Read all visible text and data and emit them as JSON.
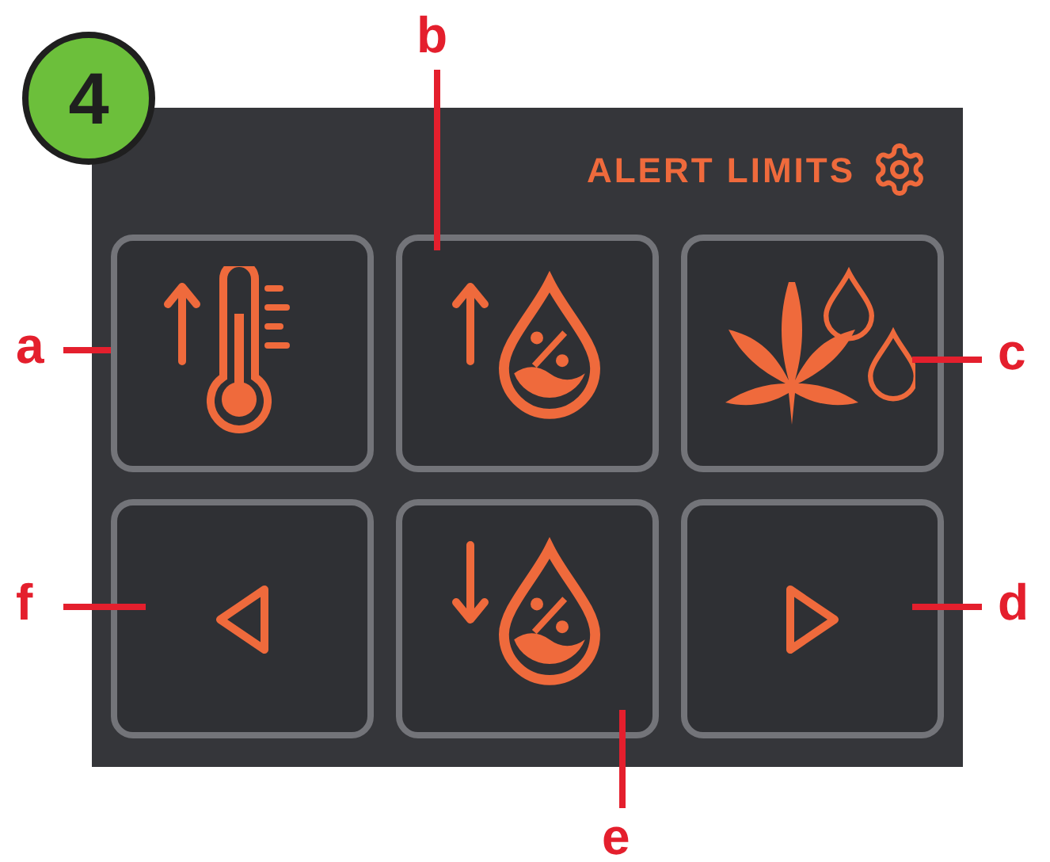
{
  "badge": "4",
  "panel": {
    "title": "ALERT LIMITS"
  },
  "buttons": [
    {
      "kind": "temp-up",
      "callout": "a"
    },
    {
      "kind": "humidity-up",
      "callout": "b"
    },
    {
      "kind": "plant-water",
      "callout": "c"
    },
    {
      "kind": "prev",
      "callout": "f"
    },
    {
      "kind": "humidity-down",
      "callout": "e"
    },
    {
      "kind": "next",
      "callout": "d"
    }
  ]
}
